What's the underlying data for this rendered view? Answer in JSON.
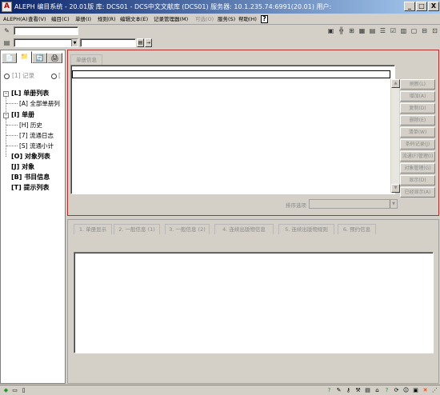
{
  "window": {
    "app_icon": "A",
    "title": "ALEPH 编目系统 - 20.01版 库: DCS01 - DCS中文文献库 (DCS01) 服务器: 10.1.235.74:6991(20.01) 用户:",
    "minimize": "_",
    "maximize": "□",
    "close": "X"
  },
  "menu": {
    "items": [
      {
        "label": "ALEPH(A)",
        "enabled": true
      },
      {
        "label": "查看(V)",
        "enabled": true
      },
      {
        "label": "编目(C)",
        "enabled": true
      },
      {
        "label": "单册(I)",
        "enabled": true
      },
      {
        "label": "规则(R)",
        "enabled": true
      },
      {
        "label": "编辑文本(E)",
        "enabled": true
      },
      {
        "label": "记录管理器(M)",
        "enabled": true
      },
      {
        "label": "可选(O)",
        "enabled": false
      },
      {
        "label": "服务(S)",
        "enabled": true
      },
      {
        "label": "帮助(H)",
        "enabled": true
      }
    ],
    "help_glyph": "?"
  },
  "toolbar": {
    "row1_field_value": "",
    "row2_combo_value": "",
    "row2_field_value": ""
  },
  "left_panel": {
    "tabs": [
      "📄",
      "📁",
      "🔄",
      "🖨"
    ],
    "radio_label": "[1] 记录",
    "radio_label_2": "[",
    "tree": [
      {
        "label": "[L] 单册列表",
        "bold": true
      },
      {
        "label": "[A] 全部单册列",
        "bold": false
      },
      {
        "label": "[I] 单册",
        "bold": true
      },
      {
        "label": "[H] 历史",
        "bold": false
      },
      {
        "label": "[7] 流通日志",
        "bold": false
      },
      {
        "label": "[S] 流通小计",
        "bold": false
      },
      {
        "label": "[O] 对象列表",
        "bold": true
      },
      {
        "label": "[J] 对象",
        "bold": true
      },
      {
        "label": "[B] 书目信息",
        "bold": true
      },
      {
        "label": "[T] 提示列表",
        "bold": true
      }
    ]
  },
  "upper_panel": {
    "tab": "单册信息",
    "sort_label": "排序选项",
    "sort_value": "",
    "buttons": [
      "刷新(L)",
      "增加(A)",
      "复制(D)",
      "删除(E)",
      "清单(W)",
      "条码记录(J)",
      "流通(F)管理(I)",
      "对象管理(G)",
      "显示(D)",
      "已经显示(A)"
    ]
  },
  "lower_panel": {
    "tabs": [
      "1. 单册显示",
      "2. 一般信息 (1)",
      "3. 一般信息 (2)",
      "4. 连续出版物信息",
      "5. 连续出版物规则",
      "6. 预约信息"
    ]
  },
  "status_icons": [
    "green-diamond-icon",
    "monitor-icon",
    "page-icon",
    "help-icon",
    "edit-icon",
    "key-icon",
    "tools-icon",
    "printer-icon",
    "lock-icon",
    "home-icon",
    "user-icon",
    "close-icon"
  ]
}
